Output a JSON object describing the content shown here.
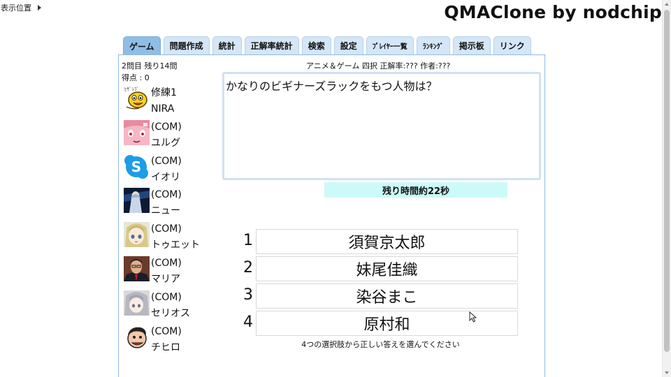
{
  "display_position": {
    "label": "表示位置"
  },
  "app": {
    "title": "QMAClone by nodchip"
  },
  "tabs": [
    {
      "label": "ゲーム",
      "active": true
    },
    {
      "label": "問題作成"
    },
    {
      "label": "統計"
    },
    {
      "label": "正解率統計"
    },
    {
      "label": "検索"
    },
    {
      "label": "設定"
    },
    {
      "label": "ﾌﾟﾚｲﾔｰ一覧"
    },
    {
      "label": "ﾗﾝｷﾝｸﾞ"
    },
    {
      "label": "掲示板"
    },
    {
      "label": "リンク"
    }
  ],
  "status": {
    "progress": "2問目 残り14問",
    "score": "得点 : 0"
  },
  "players": [
    {
      "line1": "修練1",
      "line2": "NIRA",
      "avatar": "yellow-bird-icon"
    },
    {
      "line1": "(COM)",
      "line2": "ユルグ",
      "avatar": "pink-character-icon"
    },
    {
      "line1": "(COM)",
      "line2": "イオリ",
      "avatar": "skype-logo-icon"
    },
    {
      "line1": "(COM)",
      "line2": "ニュー",
      "avatar": "dark-scene-icon"
    },
    {
      "line1": "(COM)",
      "line2": "トゥエット",
      "avatar": "anime-girl-icon"
    },
    {
      "line1": "(COM)",
      "line2": "マリア",
      "avatar": "man-photo-icon"
    },
    {
      "line1": "(COM)",
      "line2": "セリオス",
      "avatar": "silver-hair-girl-icon"
    },
    {
      "line1": "(COM)",
      "line2": "チヒロ",
      "avatar": "cartoon-face-icon"
    }
  ],
  "question": {
    "meta": "アニメ＆ゲーム 四択 正解率:??? 作者:???",
    "text": "かなりのビギナーズラックをもつ人物は？",
    "timer": "残り時間約22秒"
  },
  "choices": [
    {
      "num": "1",
      "label": "須賀京太郎"
    },
    {
      "num": "2",
      "label": "妹尾佳織"
    },
    {
      "num": "3",
      "label": "染谷まこ"
    },
    {
      "num": "4",
      "label": "原村和"
    }
  ],
  "instruction": "4つの選択肢から正しい答えを選んでください",
  "colors": {
    "tab": "#d4e6f7",
    "tab_active": "#8fbde6",
    "panel_border": "#8fb9e3",
    "timer_bg": "#ccfaf8",
    "question_border": "#cfe1f3"
  }
}
